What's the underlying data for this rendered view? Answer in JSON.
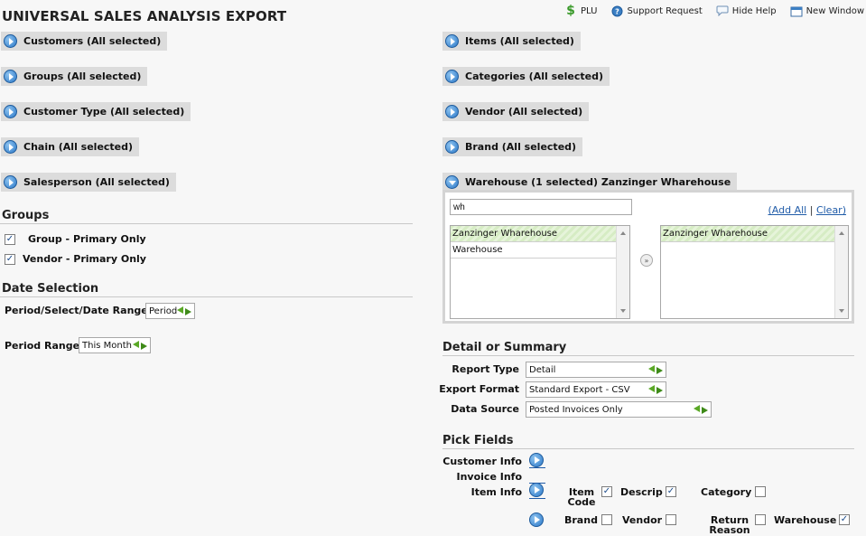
{
  "title": "UNIVERSAL SALES ANALYSIS EXPORT",
  "toplinks": [
    {
      "label": "PLU",
      "icon": "dollar-icon"
    },
    {
      "label": "Support Request",
      "icon": "support-icon"
    },
    {
      "label": "Hide Help",
      "icon": "speech-bubble-icon"
    },
    {
      "label": "New Window",
      "icon": "new-window-icon"
    }
  ],
  "left_filters": [
    "Customers (All selected)",
    "Groups (All selected)",
    "Customer Type (All selected)",
    "Chain (All selected)",
    "Salesperson (All selected)"
  ],
  "right_filters": [
    "Items (All selected)",
    "Categories (All selected)",
    "Vendor (All selected)",
    "Brand (All selected)"
  ],
  "warehouse": {
    "header": "Warehouse (1 selected) Zanzinger Wharehouse",
    "search_value": "wh",
    "add_all": "(Add All",
    "separator": "|",
    "clear": "Clear)",
    "available": [
      "Zanzinger Wharehouse",
      "Warehouse"
    ],
    "selected": [
      "Zanzinger Wharehouse"
    ]
  },
  "groups": {
    "heading": "Groups",
    "options": [
      {
        "label": "Group - Primary Only",
        "checked": true
      },
      {
        "label": "Vendor - Primary Only",
        "checked": true
      }
    ]
  },
  "date_selection": {
    "heading": "Date Selection",
    "period_label": "Period/Select/Date Range",
    "period_value": "Period",
    "range_label": "Period Range",
    "range_value": "This Month"
  },
  "detail": {
    "heading": "Detail or Summary",
    "report_type_label": "Report Type",
    "report_type_value": "Detail",
    "export_format_label": "Export Format",
    "export_format_value": "Standard Export - CSV",
    "data_source_label": "Data Source",
    "data_source_value": "Posted Invoices Only"
  },
  "pick_fields": {
    "heading": "Pick Fields",
    "customer_info": "Customer Info",
    "invoice_info": "Invoice Info",
    "item_info": "Item Info",
    "fields": {
      "item_code_1": "Item",
      "item_code_2": "Code",
      "descrip": "Descrip",
      "category": "Category",
      "brand": "Brand",
      "vendor": "Vendor",
      "return_1": "Return",
      "return_2": "Reason",
      "warehouse": "Warehouse"
    },
    "checked": {
      "item_code": true,
      "descrip": true,
      "category": false,
      "brand": false,
      "vendor": false,
      "return_reason": false,
      "warehouse": true
    }
  },
  "colors": {
    "accent": "#2b78c8",
    "bar_bg": "#dcdcdc",
    "highlight": "#d6ecc4"
  }
}
